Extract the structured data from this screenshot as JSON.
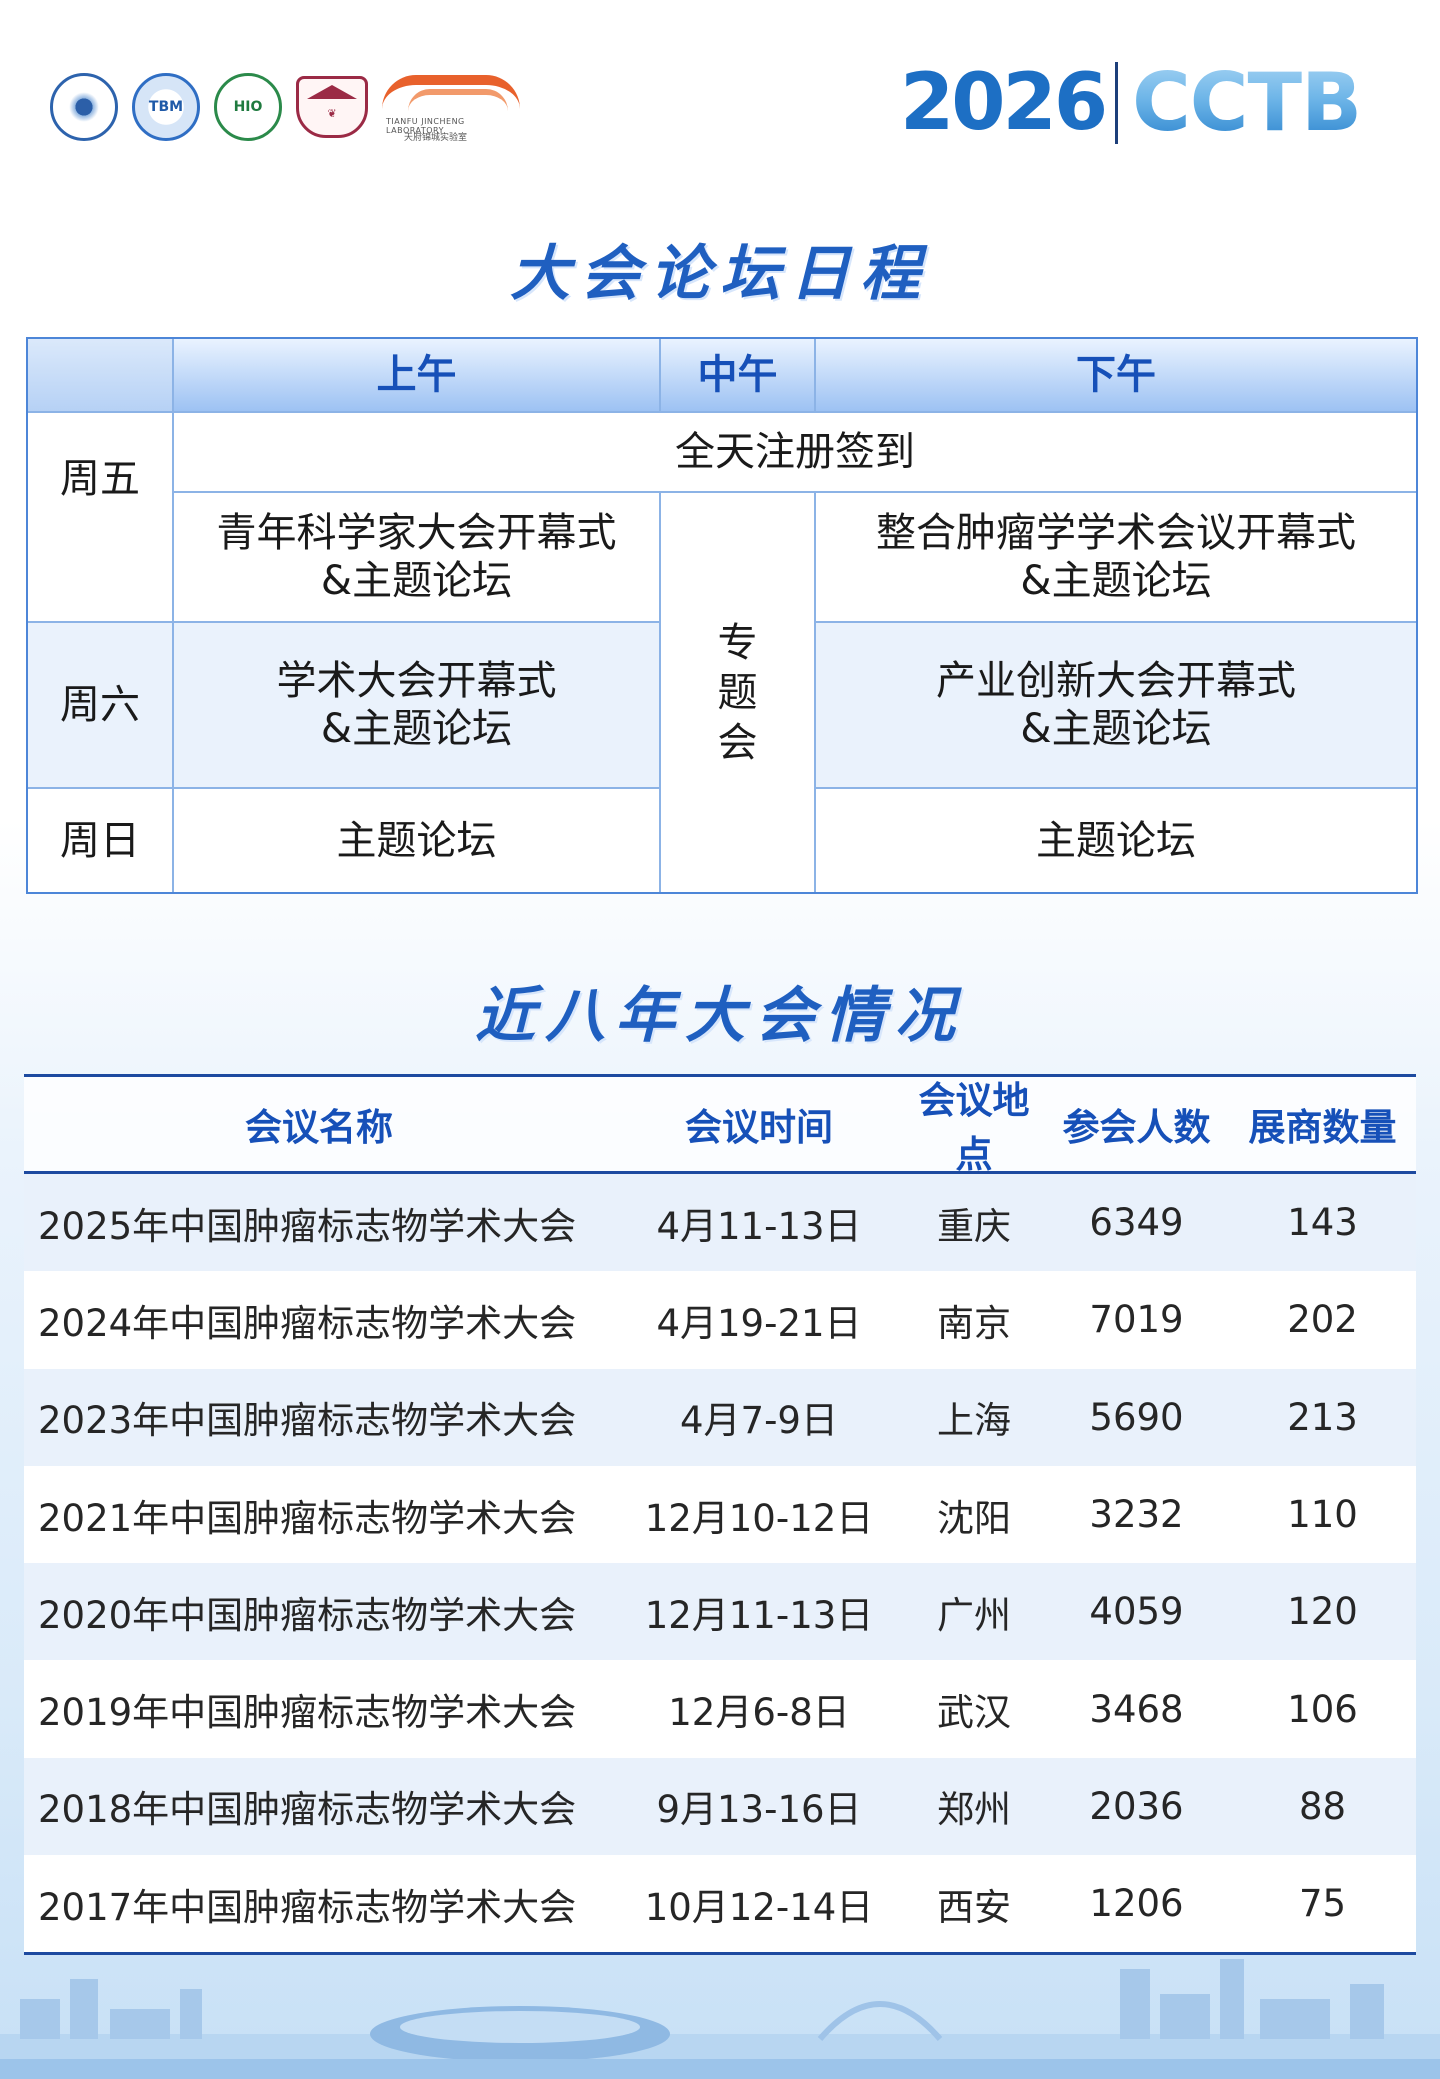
{
  "header": {
    "logos": [
      {
        "name": "china-anti-cancer-association-logo",
        "text": ""
      },
      {
        "name": "tbm-logo",
        "text": "TBM"
      },
      {
        "name": "caca-hio-logo",
        "text": "HIO"
      },
      {
        "name": "hospital-logo",
        "text": ""
      },
      {
        "name": "tianfu-jincheng-laboratory-logo",
        "text_en": "TIANFU JINCHENG LABORATORY",
        "text_cn": "天府锦城实验室"
      }
    ],
    "brand_year": "2026",
    "brand_name": "CCTB"
  },
  "schedule": {
    "title": "大会论坛日程",
    "columns": [
      "",
      "上午",
      "中午",
      "下午"
    ],
    "rows": [
      {
        "day": "周五",
        "registration": "全天注册签到",
        "morning": [
          "青年科学家大会开幕式",
          "&主题论坛"
        ],
        "afternoon": [
          "整合肿瘤学学术会议开幕式",
          "&主题论坛"
        ]
      },
      {
        "day": "周六",
        "morning": [
          "学术大会开幕式",
          "&主题论坛"
        ],
        "afternoon": [
          "产业创新大会开幕式",
          "&主题论坛"
        ]
      },
      {
        "day": "周日",
        "morning": [
          "主题论坛"
        ],
        "afternoon": [
          "主题论坛"
        ]
      }
    ],
    "noon": [
      "专",
      "题",
      "会"
    ]
  },
  "history": {
    "title": "近八年大会情况",
    "headers": [
      "会议名称",
      "会议时间",
      "会议地点",
      "参会人数",
      "展商数量"
    ],
    "rows": [
      [
        "2025年中国肿瘤标志物学术大会",
        "4月11-13日",
        "重庆",
        "6349",
        "143"
      ],
      [
        "2024年中国肿瘤标志物学术大会",
        "4月19-21日",
        "南京",
        "7019",
        "202"
      ],
      [
        "2023年中国肿瘤标志物学术大会",
        "4月7-9日",
        "上海",
        "5690",
        "213"
      ],
      [
        "2021年中国肿瘤标志物学术大会",
        "12月10-12日",
        "沈阳",
        "3232",
        "110"
      ],
      [
        "2020年中国肿瘤标志物学术大会",
        "12月11-13日",
        "广州",
        "4059",
        "120"
      ],
      [
        "2019年中国肿瘤标志物学术大会",
        "12月6-8日",
        "武汉",
        "3468",
        "106"
      ],
      [
        "2018年中国肿瘤标志物学术大会",
        "9月13-16日",
        "郑州",
        "2036",
        "88"
      ],
      [
        "2017年中国肿瘤标志物学术大会",
        "10月12-14日",
        "西安",
        "1206",
        "75"
      ]
    ]
  },
  "colors": {
    "accent": "#1f5fc0",
    "header_blue": "#1650b8",
    "table_border": "#4d86d8",
    "lab_orange": "#e8612c"
  }
}
